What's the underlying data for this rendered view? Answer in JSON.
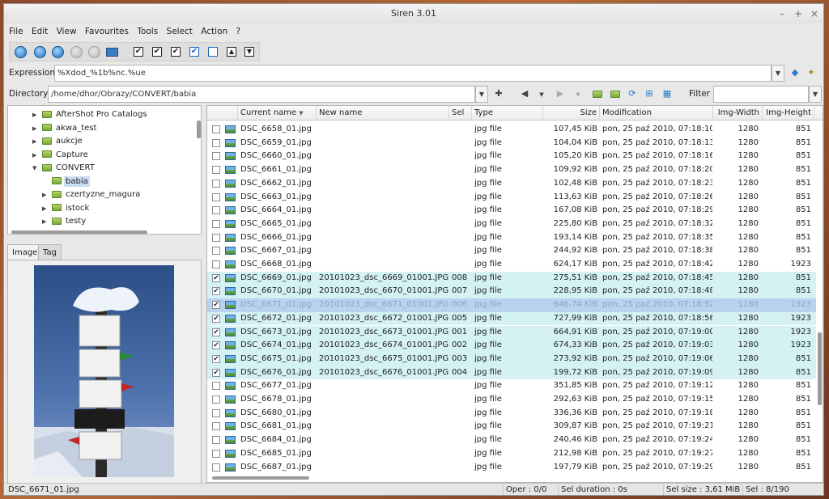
{
  "window": {
    "title": "Siren 3.01"
  },
  "menu": [
    "File",
    "Edit",
    "View",
    "Favourites",
    "Tools",
    "Select",
    "Action",
    "?"
  ],
  "expression": {
    "label": "Expression",
    "value": "%Xdod_%1b%nc.%ue"
  },
  "directory": {
    "label": "Directory",
    "value": "/home/dhor/Obrazy/CONVERT/babia"
  },
  "filter": {
    "label": "Filter",
    "value": ""
  },
  "tree": [
    {
      "label": "AfterShot Pro Catalogs",
      "arrow": "▶"
    },
    {
      "label": "akwa_test",
      "arrow": "▶"
    },
    {
      "label": "aukcje",
      "arrow": "▶"
    },
    {
      "label": "Capture",
      "arrow": "▶"
    },
    {
      "label": "CONVERT",
      "arrow": "▼"
    },
    {
      "label": "babia",
      "arrow": "",
      "selected": true
    },
    {
      "label": "czertyzne_magura",
      "arrow": "▶"
    },
    {
      "label": "istock",
      "arrow": "▶"
    },
    {
      "label": "testy",
      "arrow": "▶"
    }
  ],
  "image_tabs": {
    "image": "Image",
    "tag": "Tag"
  },
  "columns": {
    "current_name": "Current name",
    "new_name": "New name",
    "sel": "Sel",
    "type": "Type",
    "size": "Size",
    "modification": "Modification",
    "img_width": "Img-Width",
    "img_height": "Img-Height"
  },
  "files": [
    {
      "name": "DSC_6658_01.jpg",
      "new": "",
      "sel": "",
      "type": "jpg file",
      "size": "107,45 KiB",
      "mod": "pon, 25 paź 2010, 07:18:10",
      "w": "1280",
      "h": "851",
      "checked": false
    },
    {
      "name": "DSC_6659_01.jpg",
      "new": "",
      "sel": "",
      "type": "jpg file",
      "size": "104,04 KiB",
      "mod": "pon, 25 paź 2010, 07:18:13",
      "w": "1280",
      "h": "851",
      "checked": false
    },
    {
      "name": "DSC_6660_01.jpg",
      "new": "",
      "sel": "",
      "type": "jpg file",
      "size": "105,20 KiB",
      "mod": "pon, 25 paź 2010, 07:18:16",
      "w": "1280",
      "h": "851",
      "checked": false
    },
    {
      "name": "DSC_6661_01.jpg",
      "new": "",
      "sel": "",
      "type": "jpg file",
      "size": "109,92 KiB",
      "mod": "pon, 25 paź 2010, 07:18:20",
      "w": "1280",
      "h": "851",
      "checked": false
    },
    {
      "name": "DSC_6662_01.jpg",
      "new": "",
      "sel": "",
      "type": "jpg file",
      "size": "102,48 KiB",
      "mod": "pon, 25 paź 2010, 07:18:23",
      "w": "1280",
      "h": "851",
      "checked": false
    },
    {
      "name": "DSC_6663_01.jpg",
      "new": "",
      "sel": "",
      "type": "jpg file",
      "size": "113,63 KiB",
      "mod": "pon, 25 paź 2010, 07:18:26",
      "w": "1280",
      "h": "851",
      "checked": false
    },
    {
      "name": "DSC_6664_01.jpg",
      "new": "",
      "sel": "",
      "type": "jpg file",
      "size": "167,08 KiB",
      "mod": "pon, 25 paź 2010, 07:18:29",
      "w": "1280",
      "h": "851",
      "checked": false
    },
    {
      "name": "DSC_6665_01.jpg",
      "new": "",
      "sel": "",
      "type": "jpg file",
      "size": "225,80 KiB",
      "mod": "pon, 25 paź 2010, 07:18:32",
      "w": "1280",
      "h": "851",
      "checked": false
    },
    {
      "name": "DSC_6666_01.jpg",
      "new": "",
      "sel": "",
      "type": "jpg file",
      "size": "193,14 KiB",
      "mod": "pon, 25 paź 2010, 07:18:35",
      "w": "1280",
      "h": "851",
      "checked": false
    },
    {
      "name": "DSC_6667_01.jpg",
      "new": "",
      "sel": "",
      "type": "jpg file",
      "size": "244,92 KiB",
      "mod": "pon, 25 paź 2010, 07:18:38",
      "w": "1280",
      "h": "851",
      "checked": false
    },
    {
      "name": "DSC_6668_01.jpg",
      "new": "",
      "sel": "",
      "type": "jpg file",
      "size": "624,17 KiB",
      "mod": "pon, 25 paź 2010, 07:18:42",
      "w": "1280",
      "h": "1923",
      "checked": false
    },
    {
      "name": "DSC_6669_01.jpg",
      "new": "20101023_dsc_6669_01001.JPG",
      "sel": "008",
      "type": "jpg file",
      "size": "275,51 KiB",
      "mod": "pon, 25 paź 2010, 07:18:45",
      "w": "1280",
      "h": "851",
      "checked": true
    },
    {
      "name": "DSC_6670_01.jpg",
      "new": "20101023_dsc_6670_01001.JPG",
      "sel": "007",
      "type": "jpg file",
      "size": "228,95 KiB",
      "mod": "pon, 25 paź 2010, 07:18:48",
      "w": "1280",
      "h": "851",
      "checked": true
    },
    {
      "name": "DSC_6671_01.jpg",
      "new": "20101023_dsc_6671_01001.JPG",
      "sel": "006",
      "type": "jpg file",
      "size": "646,74 KiB",
      "mod": "pon, 25 paź 2010, 07:18:52",
      "w": "1280",
      "h": "1923",
      "checked": true,
      "current": true
    },
    {
      "name": "DSC_6672_01.jpg",
      "new": "20101023_dsc_6672_01001.JPG",
      "sel": "005",
      "type": "jpg file",
      "size": "727,99 KiB",
      "mod": "pon, 25 paź 2010, 07:18:56",
      "w": "1280",
      "h": "1923",
      "checked": true
    },
    {
      "name": "DSC_6673_01.jpg",
      "new": "20101023_dsc_6673_01001.JPG",
      "sel": "001",
      "type": "jpg file",
      "size": "664,91 KiB",
      "mod": "pon, 25 paź 2010, 07:19:00",
      "w": "1280",
      "h": "1923",
      "checked": true
    },
    {
      "name": "DSC_6674_01.jpg",
      "new": "20101023_dsc_6674_01001.JPG",
      "sel": "002",
      "type": "jpg file",
      "size": "674,33 KiB",
      "mod": "pon, 25 paź 2010, 07:19:03",
      "w": "1280",
      "h": "1923",
      "checked": true
    },
    {
      "name": "DSC_6675_01.jpg",
      "new": "20101023_dsc_6675_01001.JPG",
      "sel": "003",
      "type": "jpg file",
      "size": "273,92 KiB",
      "mod": "pon, 25 paź 2010, 07:19:06",
      "w": "1280",
      "h": "851",
      "checked": true
    },
    {
      "name": "DSC_6676_01.jpg",
      "new": "20101023_dsc_6676_01001.JPG",
      "sel": "004",
      "type": "jpg file",
      "size": "199,72 KiB",
      "mod": "pon, 25 paź 2010, 07:19:09",
      "w": "1280",
      "h": "851",
      "checked": true
    },
    {
      "name": "DSC_6677_01.jpg",
      "new": "",
      "sel": "",
      "type": "jpg file",
      "size": "351,85 KiB",
      "mod": "pon, 25 paź 2010, 07:19:12",
      "w": "1280",
      "h": "851",
      "checked": false
    },
    {
      "name": "DSC_6678_01.jpg",
      "new": "",
      "sel": "",
      "type": "jpg file",
      "size": "292,63 KiB",
      "mod": "pon, 25 paź 2010, 07:19:15",
      "w": "1280",
      "h": "851",
      "checked": false
    },
    {
      "name": "DSC_6680_01.jpg",
      "new": "",
      "sel": "",
      "type": "jpg file",
      "size": "336,36 KiB",
      "mod": "pon, 25 paź 2010, 07:19:18",
      "w": "1280",
      "h": "851",
      "checked": false
    },
    {
      "name": "DSC_6681_01.jpg",
      "new": "",
      "sel": "",
      "type": "jpg file",
      "size": "309,87 KiB",
      "mod": "pon, 25 paź 2010, 07:19:21",
      "w": "1280",
      "h": "851",
      "checked": false
    },
    {
      "name": "DSC_6684_01.jpg",
      "new": "",
      "sel": "",
      "type": "jpg file",
      "size": "240,46 KiB",
      "mod": "pon, 25 paź 2010, 07:19:24",
      "w": "1280",
      "h": "851",
      "checked": false
    },
    {
      "name": "DSC_6685_01.jpg",
      "new": "",
      "sel": "",
      "type": "jpg file",
      "size": "212,98 KiB",
      "mod": "pon, 25 paź 2010, 07:19:27",
      "w": "1280",
      "h": "851",
      "checked": false
    },
    {
      "name": "DSC_6687_01.jpg",
      "new": "",
      "sel": "",
      "type": "jpg file",
      "size": "197,79 KiB",
      "mod": "pon, 25 paź 2010, 07:19:29",
      "w": "1280",
      "h": "851",
      "checked": false
    }
  ],
  "status": {
    "file": "DSC_6671_01.jpg",
    "oper": "Oper : 0/0",
    "duration": "Sel duration : 0s",
    "size": "Sel size : 3,61 MiB",
    "sel": "Sel : 8/190"
  },
  "icons": {
    "check": "✔",
    "sort_desc": "▼",
    "dropdown": "▼",
    "add": "✚",
    "back": "◀",
    "forward": "▶",
    "wand": "✦"
  },
  "colors": {
    "selected_row": "#d4f1f4",
    "current_row": "#b9d2ee",
    "folder": "#79a838"
  }
}
